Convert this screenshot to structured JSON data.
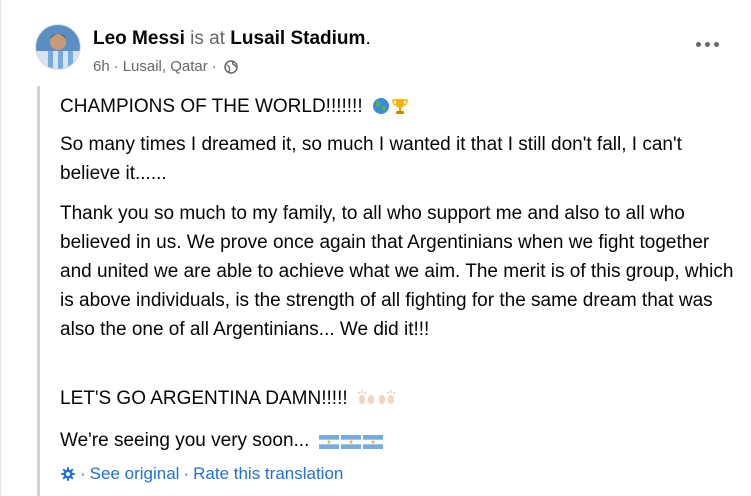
{
  "post": {
    "author": "Leo Messi",
    "is_at": "is at",
    "place": "Lusail Stadium",
    "period": ".",
    "time": "6h",
    "location": "Lusail, Qatar",
    "separator": "·",
    "privacy_icon": "globe-icon",
    "more_icon": "more-options-icon"
  },
  "content": {
    "p1": "CHAMPIONS OF THE WORLD!!!!!!!",
    "p1_emojis": [
      "globe-emoji",
      "trophy-emoji"
    ],
    "p2": "So many times I dreamed it, so much I wanted it that I still don't fall, I can't believe it......",
    "p3": "Thank you so much to my family, to all who support me and also to all who believed in us. We prove once again that Argentinians when we fight together and united we are able to achieve what we aim. The merit is of this group, which is above individuals, is the strength of all fighting for the same dream that was also the one of all Argentinians... We did it!!!",
    "p4": "LET'S GO ARGENTINA DAMN!!!!!",
    "p4_emojis": [
      "raised-hands-emoji",
      "raised-hands-emoji"
    ],
    "p5": "We're seeing you very soon...",
    "p5_emojis": [
      "argentina-flag-emoji",
      "argentina-flag-emoji",
      "argentina-flag-emoji"
    ]
  },
  "translation": {
    "icon": "gear-icon",
    "separator": "·",
    "see_original": "See original",
    "rate": "Rate this translation"
  },
  "colors": {
    "link": "#216fdb",
    "muted": "#65676b",
    "text": "#050505",
    "quote_bar": "#cfd2d6"
  }
}
